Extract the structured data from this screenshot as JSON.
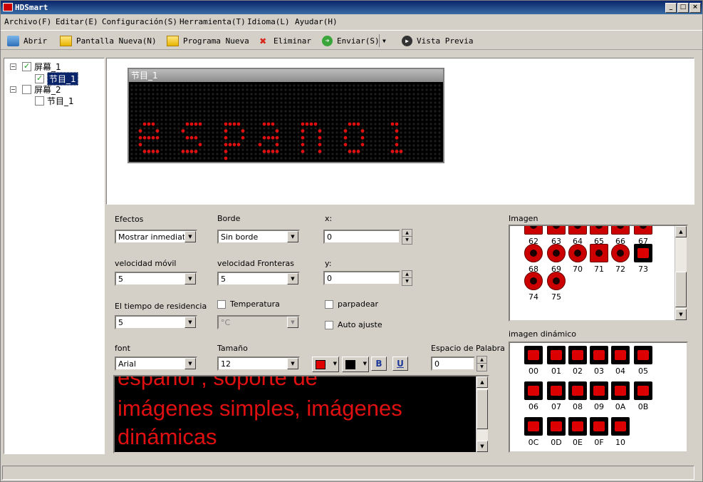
{
  "window": {
    "title": "HDSmart",
    "colors": {
      "title_from": "#0a246a",
      "title_to": "#3a6ea5",
      "led_on": "#e01010"
    }
  },
  "menu": [
    {
      "label": "Archivo(F)",
      "name": "archivo"
    },
    {
      "label": "Editar(E)",
      "name": "editar"
    },
    {
      "label": "Configuración(S)",
      "name": "configuracion"
    },
    {
      "label": "Herramienta(T)",
      "name": "herramienta"
    },
    {
      "label": "Idioma(L)",
      "name": "idioma"
    },
    {
      "label": "Ayudar(H)",
      "name": "ayudar"
    }
  ],
  "toolbar": {
    "open": "Abrir",
    "new_screen": "Pantalla Nueva(N)",
    "new_program": "Programa Nueva",
    "delete": "Eliminar",
    "send": "Enviar(S)",
    "preview": "Vista Previa"
  },
  "tree": [
    {
      "label": "屏幕_1",
      "checked": true,
      "expanded": true
    },
    {
      "label": "节目_1",
      "checked": true,
      "selected": true
    },
    {
      "label": "屏幕_2",
      "checked": false,
      "expanded": true
    },
    {
      "label": "节目_1",
      "checked": false
    }
  ],
  "preview": {
    "window_title": "节目_1"
  },
  "props": {
    "effects_label": "Efectos",
    "effects_value": "Mostrar inmediatam",
    "border_label": "Borde",
    "border_value": "Sin borde",
    "x_label": "x:",
    "x_value": "0",
    "speed_label": "velocidad móvil",
    "speed_value": "5",
    "border_speed_label": "velocidad Fronteras",
    "border_speed_value": "5",
    "y_label": "y:",
    "y_value": "0",
    "stay_label": "El tiempo de residencia",
    "stay_value": "5",
    "temp_label": "Temperatura",
    "temp_unit": "°C",
    "blink_label": "parpadear",
    "autofit_label": "Auto ajuste",
    "font_label": "font",
    "font_value": "Arial",
    "size_label": "Tamaño",
    "size_value": "12",
    "bold": "B",
    "underline": "U",
    "spacing_label": "Espacio de Palabra",
    "spacing_value": "0",
    "fg_color": "#e00000",
    "bg_color": "#000000"
  },
  "editor": {
    "lines": [
      "español , soporte de",
      "imágenes simples, imágenes",
      "dinámicas"
    ]
  },
  "image_panel": {
    "label": "Imagen",
    "items": [
      "62",
      "63",
      "64",
      "65",
      "66",
      "67",
      "68",
      "69",
      "70",
      "71",
      "72",
      "73",
      "74",
      "75"
    ]
  },
  "dyn_panel": {
    "label": "imagen dinámico",
    "items": [
      "00",
      "01",
      "02",
      "03",
      "04",
      "05",
      "06",
      "07",
      "08",
      "09",
      "0A",
      "0B",
      "0C",
      "0D",
      "0E",
      "0F",
      "10"
    ]
  }
}
